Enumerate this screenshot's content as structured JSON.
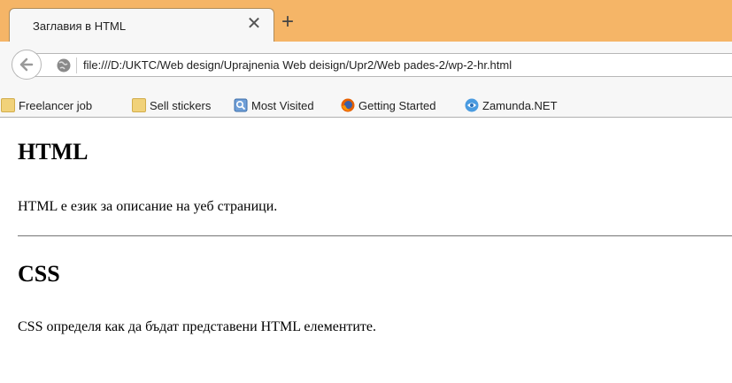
{
  "tab": {
    "title": "Заглавия в HTML",
    "close_glyph": "✕",
    "new_tab_glyph": "+"
  },
  "navbar": {
    "url": "file:///D:/UKTC/Web design/Uprajnenia Web deisign/Upr2/Web pades-2/wp-2-hr.html"
  },
  "bookmarks": [
    {
      "label": "Freelancer job",
      "icon": "folder-icon"
    },
    {
      "label": "Sell stickers",
      "icon": "folder-icon"
    },
    {
      "label": "Most Visited",
      "icon": "most-visited-icon"
    },
    {
      "label": "Getting Started",
      "icon": "firefox-icon"
    },
    {
      "label": "Zamunda.NET",
      "icon": "zamunda-icon"
    }
  ],
  "page": {
    "heading1": "HTML",
    "paragraph1": "HTML е език за описание на уеб страници.",
    "heading2": "CSS",
    "paragraph2": "CSS определя как да бъдат представени HTML елементите."
  },
  "colors": {
    "tabstrip": "#f5b567",
    "toolbar": "#f7f7f7"
  }
}
